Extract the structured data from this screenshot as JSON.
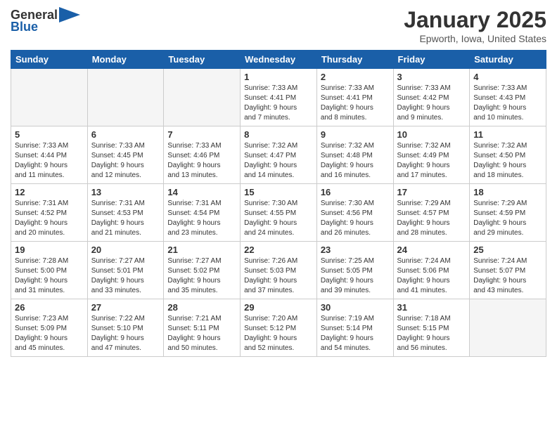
{
  "header": {
    "logo_general": "General",
    "logo_blue": "Blue",
    "month_title": "January 2025",
    "location": "Epworth, Iowa, United States"
  },
  "weekdays": [
    "Sunday",
    "Monday",
    "Tuesday",
    "Wednesday",
    "Thursday",
    "Friday",
    "Saturday"
  ],
  "weeks": [
    [
      {
        "day": "",
        "info": ""
      },
      {
        "day": "",
        "info": ""
      },
      {
        "day": "",
        "info": ""
      },
      {
        "day": "1",
        "info": "Sunrise: 7:33 AM\nSunset: 4:41 PM\nDaylight: 9 hours\nand 7 minutes."
      },
      {
        "day": "2",
        "info": "Sunrise: 7:33 AM\nSunset: 4:41 PM\nDaylight: 9 hours\nand 8 minutes."
      },
      {
        "day": "3",
        "info": "Sunrise: 7:33 AM\nSunset: 4:42 PM\nDaylight: 9 hours\nand 9 minutes."
      },
      {
        "day": "4",
        "info": "Sunrise: 7:33 AM\nSunset: 4:43 PM\nDaylight: 9 hours\nand 10 minutes."
      }
    ],
    [
      {
        "day": "5",
        "info": "Sunrise: 7:33 AM\nSunset: 4:44 PM\nDaylight: 9 hours\nand 11 minutes."
      },
      {
        "day": "6",
        "info": "Sunrise: 7:33 AM\nSunset: 4:45 PM\nDaylight: 9 hours\nand 12 minutes."
      },
      {
        "day": "7",
        "info": "Sunrise: 7:33 AM\nSunset: 4:46 PM\nDaylight: 9 hours\nand 13 minutes."
      },
      {
        "day": "8",
        "info": "Sunrise: 7:32 AM\nSunset: 4:47 PM\nDaylight: 9 hours\nand 14 minutes."
      },
      {
        "day": "9",
        "info": "Sunrise: 7:32 AM\nSunset: 4:48 PM\nDaylight: 9 hours\nand 16 minutes."
      },
      {
        "day": "10",
        "info": "Sunrise: 7:32 AM\nSunset: 4:49 PM\nDaylight: 9 hours\nand 17 minutes."
      },
      {
        "day": "11",
        "info": "Sunrise: 7:32 AM\nSunset: 4:50 PM\nDaylight: 9 hours\nand 18 minutes."
      }
    ],
    [
      {
        "day": "12",
        "info": "Sunrise: 7:31 AM\nSunset: 4:52 PM\nDaylight: 9 hours\nand 20 minutes."
      },
      {
        "day": "13",
        "info": "Sunrise: 7:31 AM\nSunset: 4:53 PM\nDaylight: 9 hours\nand 21 minutes."
      },
      {
        "day": "14",
        "info": "Sunrise: 7:31 AM\nSunset: 4:54 PM\nDaylight: 9 hours\nand 23 minutes."
      },
      {
        "day": "15",
        "info": "Sunrise: 7:30 AM\nSunset: 4:55 PM\nDaylight: 9 hours\nand 24 minutes."
      },
      {
        "day": "16",
        "info": "Sunrise: 7:30 AM\nSunset: 4:56 PM\nDaylight: 9 hours\nand 26 minutes."
      },
      {
        "day": "17",
        "info": "Sunrise: 7:29 AM\nSunset: 4:57 PM\nDaylight: 9 hours\nand 28 minutes."
      },
      {
        "day": "18",
        "info": "Sunrise: 7:29 AM\nSunset: 4:59 PM\nDaylight: 9 hours\nand 29 minutes."
      }
    ],
    [
      {
        "day": "19",
        "info": "Sunrise: 7:28 AM\nSunset: 5:00 PM\nDaylight: 9 hours\nand 31 minutes."
      },
      {
        "day": "20",
        "info": "Sunrise: 7:27 AM\nSunset: 5:01 PM\nDaylight: 9 hours\nand 33 minutes."
      },
      {
        "day": "21",
        "info": "Sunrise: 7:27 AM\nSunset: 5:02 PM\nDaylight: 9 hours\nand 35 minutes."
      },
      {
        "day": "22",
        "info": "Sunrise: 7:26 AM\nSunset: 5:03 PM\nDaylight: 9 hours\nand 37 minutes."
      },
      {
        "day": "23",
        "info": "Sunrise: 7:25 AM\nSunset: 5:05 PM\nDaylight: 9 hours\nand 39 minutes."
      },
      {
        "day": "24",
        "info": "Sunrise: 7:24 AM\nSunset: 5:06 PM\nDaylight: 9 hours\nand 41 minutes."
      },
      {
        "day": "25",
        "info": "Sunrise: 7:24 AM\nSunset: 5:07 PM\nDaylight: 9 hours\nand 43 minutes."
      }
    ],
    [
      {
        "day": "26",
        "info": "Sunrise: 7:23 AM\nSunset: 5:09 PM\nDaylight: 9 hours\nand 45 minutes."
      },
      {
        "day": "27",
        "info": "Sunrise: 7:22 AM\nSunset: 5:10 PM\nDaylight: 9 hours\nand 47 minutes."
      },
      {
        "day": "28",
        "info": "Sunrise: 7:21 AM\nSunset: 5:11 PM\nDaylight: 9 hours\nand 50 minutes."
      },
      {
        "day": "29",
        "info": "Sunrise: 7:20 AM\nSunset: 5:12 PM\nDaylight: 9 hours\nand 52 minutes."
      },
      {
        "day": "30",
        "info": "Sunrise: 7:19 AM\nSunset: 5:14 PM\nDaylight: 9 hours\nand 54 minutes."
      },
      {
        "day": "31",
        "info": "Sunrise: 7:18 AM\nSunset: 5:15 PM\nDaylight: 9 hours\nand 56 minutes."
      },
      {
        "day": "",
        "info": ""
      }
    ]
  ]
}
